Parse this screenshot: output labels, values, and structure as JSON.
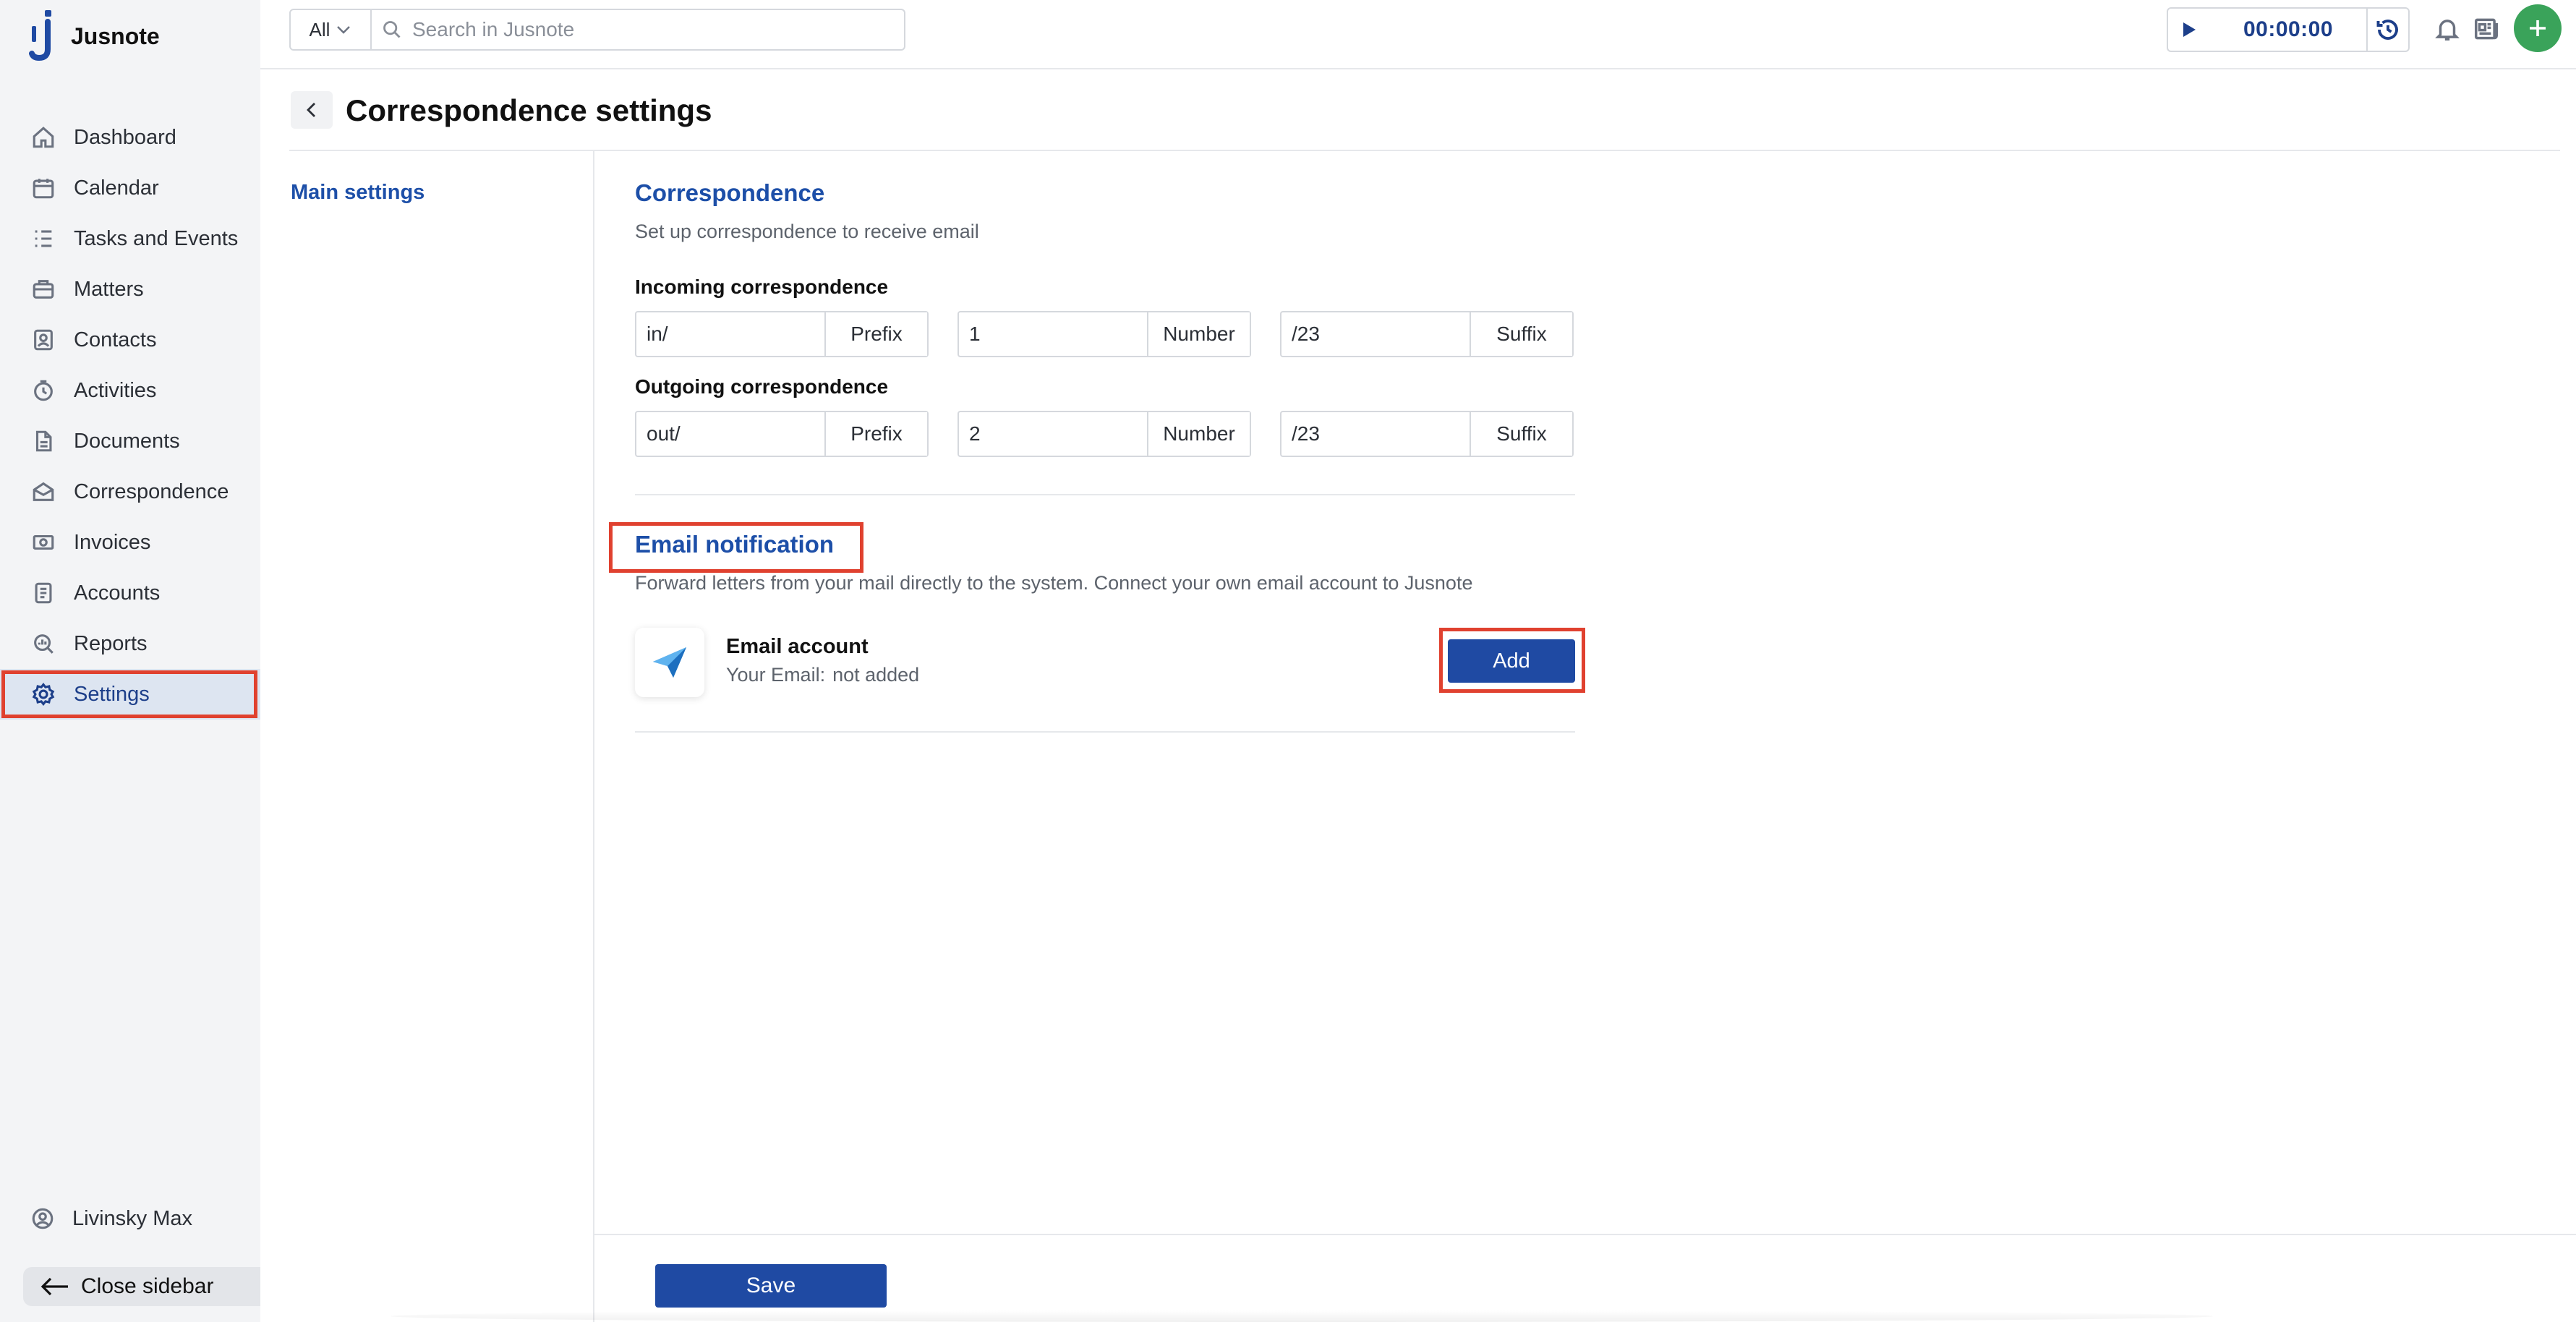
{
  "app": {
    "name": "Jusnote"
  },
  "sidebar": {
    "items": [
      {
        "label": "Dashboard",
        "icon": "home-icon"
      },
      {
        "label": "Calendar",
        "icon": "calendar-icon"
      },
      {
        "label": "Tasks and Events",
        "icon": "tasks-icon"
      },
      {
        "label": "Matters",
        "icon": "briefcase-icon"
      },
      {
        "label": "Contacts",
        "icon": "contacts-icon"
      },
      {
        "label": "Activities",
        "icon": "activity-icon"
      },
      {
        "label": "Documents",
        "icon": "documents-icon"
      },
      {
        "label": "Correspondence",
        "icon": "correspondence-icon"
      },
      {
        "label": "Invoices",
        "icon": "invoice-icon"
      },
      {
        "label": "Accounts",
        "icon": "accounts-icon"
      },
      {
        "label": "Reports",
        "icon": "reports-icon"
      },
      {
        "label": "Settings",
        "icon": "gear-icon",
        "active": true
      }
    ],
    "user": "Livinsky Max",
    "close_label": "Close sidebar"
  },
  "topbar": {
    "filter_value": "All",
    "search_placeholder": "Search in Jusnote",
    "timer": "00:00:00"
  },
  "page": {
    "title": "Correspondence settings",
    "subnav": "Main settings"
  },
  "correspondence": {
    "title": "Correspondence",
    "description": "Set up correspondence to receive email",
    "incoming": {
      "label": "Incoming correspondence",
      "prefix_value": "in/",
      "prefix_tag": "Prefix",
      "number_value": "1",
      "number_tag": "Number",
      "suffix_value": "/23",
      "suffix_tag": "Suffix"
    },
    "outgoing": {
      "label": "Outgoing correspondence",
      "prefix_value": "out/",
      "prefix_tag": "Prefix",
      "number_value": "2",
      "number_tag": "Number",
      "suffix_value": "/23",
      "suffix_tag": "Suffix"
    }
  },
  "email": {
    "title": "Email notification",
    "description": "Forward letters from your mail directly to the system. Connect your own email account to Jusnote",
    "account_title": "Email account",
    "account_email_label": "Your Email:",
    "account_email_value": "not added",
    "add_label": "Add"
  },
  "footer": {
    "save_label": "Save"
  },
  "colors": {
    "brand_blue": "#1f4aa3",
    "accent_link": "#1d4fa8",
    "highlight_red": "#e0412f",
    "plus_green": "#3aa35a"
  }
}
